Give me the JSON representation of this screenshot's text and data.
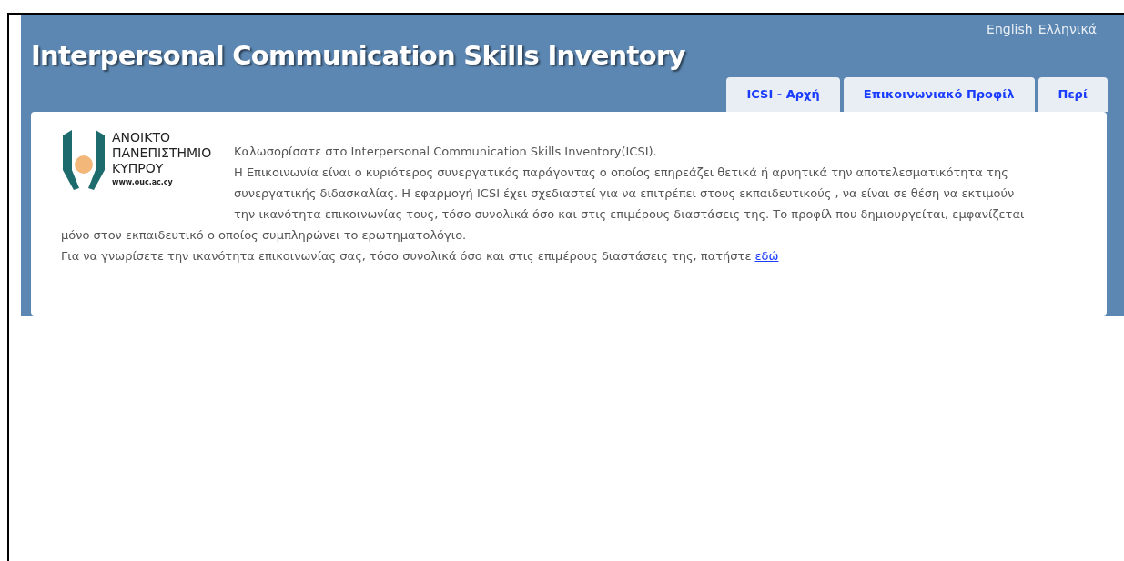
{
  "languages": [
    {
      "label": "English"
    },
    {
      "label": "Ελληνικά"
    }
  ],
  "title": "Interpersonal Communication Skills Inventory",
  "tabs": [
    {
      "label": "ICSI - Αρχή"
    },
    {
      "label": "Επικοινωνιακό Προφίλ"
    },
    {
      "label": "Περί"
    }
  ],
  "logo": {
    "lines": [
      "ΑΝΟΙΚΤΟ",
      "ΠΑΝΕΠΙΣΤΗΜΙΟ",
      "ΚΥΠΡΟΥ"
    ],
    "url": "www.ouc.ac.cy"
  },
  "welcome": "Καλωσορίσατε στο Interpersonal Communication Skills Inventory(ICSI).",
  "intro_lines": [
    "Η Επικοινωνία είναι ο κυριότερος συνεργατικός παράγοντας ο οποίος επηρεάζει θετικά ή αρνητικά την αποτελεσματικότητα της",
    "συνεργατικής διδασκαλίας. Η εφαρμογή ICSI έχει σχεδιαστεί για να επιτρέπει στους εκπαιδευτικούς , να είναι σε θέση να εκτιμούν",
    "την ικανότητα επικοινωνίας τους, τόσο συνολικά όσο και στις επιμέρους διαστάσεις της. Το προφίλ που δημιουργείται, εμφανίζεται"
  ],
  "intro_tail": "μόνο στον εκπαιδευτικό ο οποίος συμπληρώνει το ερωτηματολόγιο.",
  "cta": {
    "text": "Για να γνωρίσετε την ικανότητα επικοινωνίας σας, τόσο συνολικά όσο και στις επιμέρους διαστάσεις της, πατήστε",
    "link": "εδώ"
  }
}
